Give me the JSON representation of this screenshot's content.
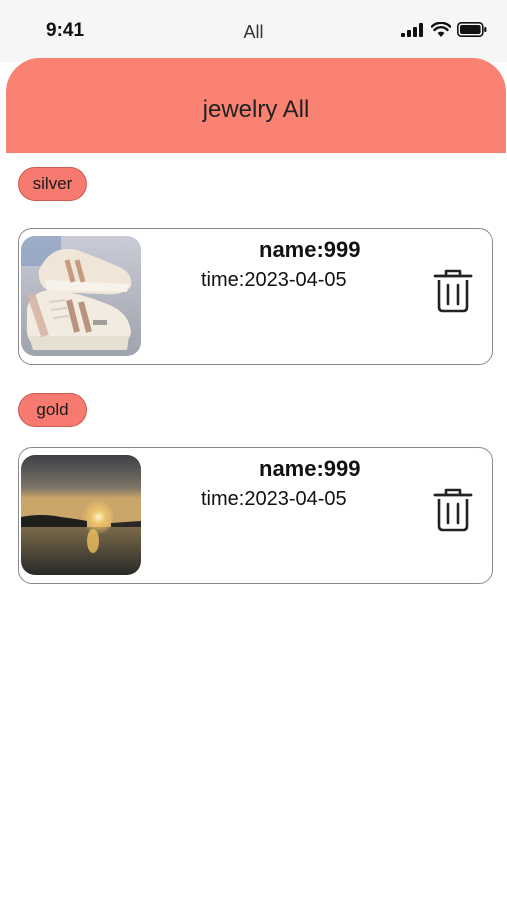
{
  "status_bar": {
    "time": "9:41",
    "title": "All",
    "icons": [
      "signal-icon",
      "wifi-icon",
      "battery-icon"
    ]
  },
  "header": {
    "title": "jewelry All",
    "color": "#f98272"
  },
  "groups": [
    {
      "tag": "silver",
      "items": [
        {
          "name": "name:999",
          "time": "time:2023-04-05",
          "image": "sneakers-photo"
        }
      ]
    },
    {
      "tag": "gold",
      "items": [
        {
          "name": "name:999",
          "time": "time:2023-04-05",
          "image": "sunset-lake-photo"
        }
      ]
    }
  ],
  "colors": {
    "tag_bg": "#f67a70",
    "card_border": "#8a8a8a"
  }
}
